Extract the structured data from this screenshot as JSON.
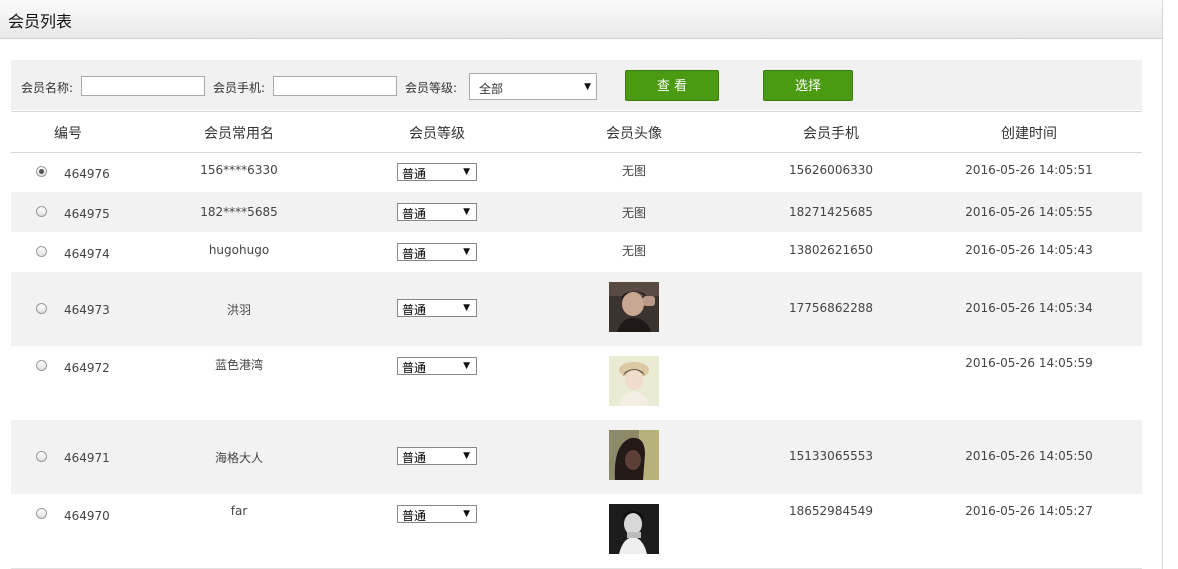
{
  "page": {
    "title": "会员列表"
  },
  "filter": {
    "name_label": "会员名称:",
    "name_value": "",
    "phone_label": "会员手机:",
    "phone_value": "",
    "level_label": "会员等级:",
    "level_value": "全部",
    "view_button": "查 看",
    "select_button": "选择"
  },
  "table": {
    "headers": [
      "编号",
      "会员常用名",
      "会员等级",
      "会员头像",
      "会员手机",
      "创建时间"
    ],
    "rows": [
      {
        "id": "464976",
        "name": "156****6330",
        "level": "普通",
        "avatar_text": "无图",
        "phone": "15626006330",
        "created": "2016-05-26 14:05:51",
        "selected": true
      },
      {
        "id": "464975",
        "name": "182****5685",
        "level": "普通",
        "avatar_text": "无图",
        "phone": "18271425685",
        "created": "2016-05-26 14:05:55",
        "selected": false
      },
      {
        "id": "464974",
        "name": "hugohugo",
        "level": "普通",
        "avatar_text": "无图",
        "phone": "13802621650",
        "created": "2016-05-26 14:05:43",
        "selected": false
      },
      {
        "id": "464973",
        "name": "洪羽",
        "level": "普通",
        "avatar_text": "",
        "phone": "17756862288",
        "created": "2016-05-26 14:05:34",
        "selected": false
      },
      {
        "id": "464972",
        "name": "蓝色港湾",
        "level": "普通",
        "avatar_text": "",
        "phone": "",
        "created": "2016-05-26 14:05:59",
        "selected": false
      },
      {
        "id": "464971",
        "name": "海格大人",
        "level": "普通",
        "avatar_text": "",
        "phone": "15133065553",
        "created": "2016-05-26 14:05:50",
        "selected": false
      },
      {
        "id": "464970",
        "name": "far",
        "level": "普通",
        "avatar_text": "",
        "phone": "18652984549",
        "created": "2016-05-26 14:05:27",
        "selected": false
      }
    ]
  },
  "icons": {
    "dropdown": "caret-down-icon",
    "radio": "radio-icon",
    "avatar": "avatar-photo"
  },
  "colors": {
    "primary_button": "#4a9a12",
    "row_alt": "#f2f2f2"
  }
}
